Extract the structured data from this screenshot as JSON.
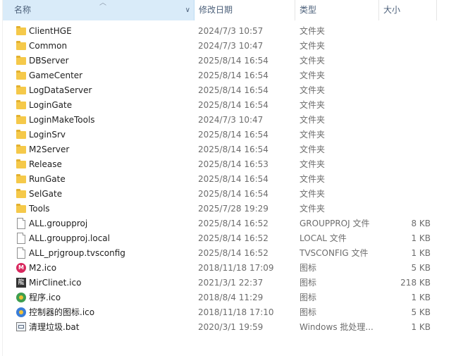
{
  "columns": {
    "name": "名称",
    "date": "修改日期",
    "type": "类型",
    "size": "大小"
  },
  "files": [
    {
      "name": "ClientHGE",
      "date": "2024/7/3 10:57",
      "type": "文件夹",
      "size": "",
      "icon": "folder-icon"
    },
    {
      "name": "Common",
      "date": "2024/7/3 10:47",
      "type": "文件夹",
      "size": "",
      "icon": "folder-icon"
    },
    {
      "name": "DBServer",
      "date": "2025/8/14 16:54",
      "type": "文件夹",
      "size": "",
      "icon": "folder-icon"
    },
    {
      "name": "GameCenter",
      "date": "2025/8/14 16:54",
      "type": "文件夹",
      "size": "",
      "icon": "folder-icon"
    },
    {
      "name": "LogDataServer",
      "date": "2025/8/14 16:54",
      "type": "文件夹",
      "size": "",
      "icon": "folder-icon"
    },
    {
      "name": "LoginGate",
      "date": "2025/8/14 16:54",
      "type": "文件夹",
      "size": "",
      "icon": "folder-icon"
    },
    {
      "name": "LoginMakeTools",
      "date": "2024/7/3 10:47",
      "type": "文件夹",
      "size": "",
      "icon": "folder-icon"
    },
    {
      "name": "LoginSrv",
      "date": "2025/8/14 16:54",
      "type": "文件夹",
      "size": "",
      "icon": "folder-icon"
    },
    {
      "name": "M2Server",
      "date": "2025/8/14 16:54",
      "type": "文件夹",
      "size": "",
      "icon": "folder-icon"
    },
    {
      "name": "Release",
      "date": "2025/8/14 16:53",
      "type": "文件夹",
      "size": "",
      "icon": "folder-icon"
    },
    {
      "name": "RunGate",
      "date": "2025/8/14 16:54",
      "type": "文件夹",
      "size": "",
      "icon": "folder-icon"
    },
    {
      "name": "SelGate",
      "date": "2025/8/14 16:54",
      "type": "文件夹",
      "size": "",
      "icon": "folder-icon"
    },
    {
      "name": "Tools",
      "date": "2025/7/28 19:29",
      "type": "文件夹",
      "size": "",
      "icon": "folder-icon"
    },
    {
      "name": "ALL.groupproj",
      "date": "2025/8/14 16:52",
      "type": "GROUPPROJ 文件",
      "size": "8 KB",
      "icon": "file-icon"
    },
    {
      "name": "ALL.groupproj.local",
      "date": "2025/8/14 16:52",
      "type": "LOCAL 文件",
      "size": "1 KB",
      "icon": "file-icon"
    },
    {
      "name": "ALL_prjgroup.tvsconfig",
      "date": "2025/8/14 16:52",
      "type": "TVSCONFIG 文件",
      "size": "1 KB",
      "icon": "file-icon"
    },
    {
      "name": "M2.ico",
      "date": "2018/11/18 17:09",
      "type": "图标",
      "size": "5 KB",
      "icon": "m2-ico-icon"
    },
    {
      "name": "MirClinet.ico",
      "date": "2021/3/1 22:37",
      "type": "图标",
      "size": "218 KB",
      "icon": "mirclinet-ico-icon"
    },
    {
      "name": "程序.ico",
      "date": "2018/8/4 11:29",
      "type": "图标",
      "size": "1 KB",
      "icon": "app-ico-icon"
    },
    {
      "name": "控制器的图标.ico",
      "date": "2018/11/18 17:10",
      "type": "图标",
      "size": "5 KB",
      "icon": "controller-ico-icon"
    },
    {
      "name": "清理垃圾.bat",
      "date": "2020/3/1 19:59",
      "type": "Windows 批处理...",
      "size": "1 KB",
      "icon": "bat-file-icon"
    }
  ],
  "colors": {
    "header_selected": "#d9ebf9",
    "folder": "#f5c94a",
    "secondary_text": "#6d6d6d"
  }
}
